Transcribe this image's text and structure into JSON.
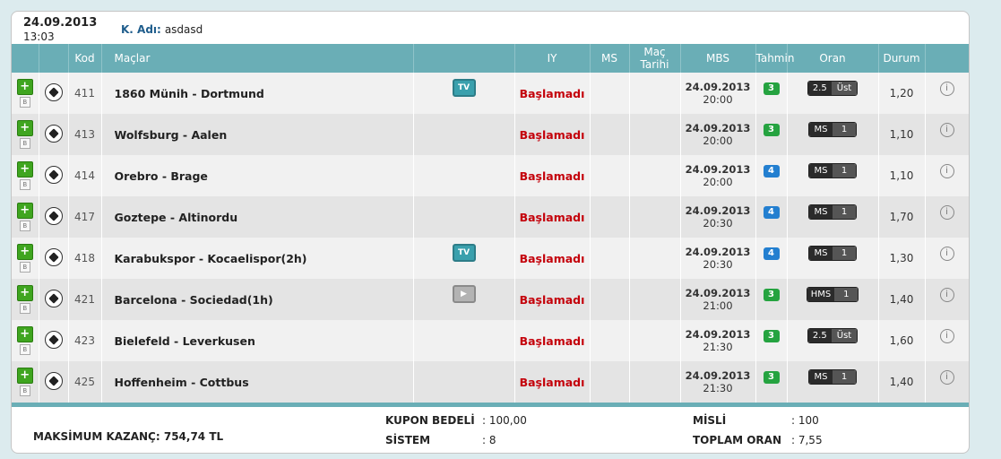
{
  "header": {
    "date": "24.09.2013",
    "time": "13:03",
    "user_label": "K. Adı:",
    "user_value": "asdasd"
  },
  "columns": {
    "kod": "Kod",
    "maclar": "Maçlar",
    "iy": "IY",
    "ms": "MS",
    "tarih": "Maç Tarihi",
    "mbs": "MBS",
    "tahmin": "Tahmin",
    "oran": "Oran",
    "durum": "Durum"
  },
  "rows": [
    {
      "kod": "411",
      "match": "1860 Münih - Dortmund",
      "tv": "TV",
      "tv_style": "live",
      "status": "Başlamadı",
      "date": "24.09.2013",
      "time": "20:00",
      "mbs": "3",
      "mbs_color": "#25a340",
      "pred_a": "2.5",
      "pred_b": "Üst",
      "oran": "1,20"
    },
    {
      "kod": "413",
      "match": "Wolfsburg - Aalen",
      "tv": "",
      "tv_style": "none",
      "status": "Başlamadı",
      "date": "24.09.2013",
      "time": "20:00",
      "mbs": "3",
      "mbs_color": "#25a340",
      "pred_a": "MS",
      "pred_b": "1",
      "oran": "1,10"
    },
    {
      "kod": "414",
      "match": "Orebro - Brage",
      "tv": "",
      "tv_style": "none",
      "status": "Başlamadı",
      "date": "24.09.2013",
      "time": "20:00",
      "mbs": "4",
      "mbs_color": "#237fd0",
      "pred_a": "MS",
      "pred_b": "1",
      "oran": "1,10"
    },
    {
      "kod": "417",
      "match": "Goztepe - Altinordu",
      "tv": "",
      "tv_style": "none",
      "status": "Başlamadı",
      "date": "24.09.2013",
      "time": "20:30",
      "mbs": "4",
      "mbs_color": "#237fd0",
      "pred_a": "MS",
      "pred_b": "1",
      "oran": "1,70"
    },
    {
      "kod": "418",
      "match": "Karabukspor - Kocaelispor(2h)",
      "tv": "TV",
      "tv_style": "live",
      "status": "Başlamadı",
      "date": "24.09.2013",
      "time": "20:30",
      "mbs": "4",
      "mbs_color": "#237fd0",
      "pred_a": "MS",
      "pred_b": "1",
      "oran": "1,30"
    },
    {
      "kod": "421",
      "match": "Barcelona - Sociedad(1h)",
      "tv": "▶",
      "tv_style": "gray",
      "status": "Başlamadı",
      "date": "24.09.2013",
      "time": "21:00",
      "mbs": "3",
      "mbs_color": "#25a340",
      "pred_a": "HMS",
      "pred_b": "1",
      "oran": "1,40"
    },
    {
      "kod": "423",
      "match": "Bielefeld - Leverkusen",
      "tv": "",
      "tv_style": "none",
      "status": "Başlamadı",
      "date": "24.09.2013",
      "time": "21:30",
      "mbs": "3",
      "mbs_color": "#25a340",
      "pred_a": "2.5",
      "pred_b": "Üst",
      "oran": "1,60"
    },
    {
      "kod": "425",
      "match": "Hoffenheim - Cottbus",
      "tv": "",
      "tv_style": "none",
      "status": "Başlamadı",
      "date": "24.09.2013",
      "time": "21:30",
      "mbs": "3",
      "mbs_color": "#25a340",
      "pred_a": "MS",
      "pred_b": "1",
      "oran": "1,40"
    }
  ],
  "icons": {
    "add": "plus-icon",
    "b": "b-icon",
    "ball": "soccer-ball-icon",
    "tv": "tv-icon",
    "info": "info-icon",
    "b_glyph": "B",
    "plus_glyph": "+",
    "info_glyph": "i"
  },
  "footer": {
    "max_win": "MAKSİMUM KAZANÇ: 754,74 TL",
    "kupon_label": "KUPON BEDELİ",
    "kupon_value": ": 100,00",
    "sistem_label": "SİSTEM",
    "sistem_value": ": 8",
    "misli_label": "MİSLİ",
    "misli_value": ": 100",
    "toplam_label": "TOPLAM ORAN",
    "toplam_value": ": 7,55"
  }
}
